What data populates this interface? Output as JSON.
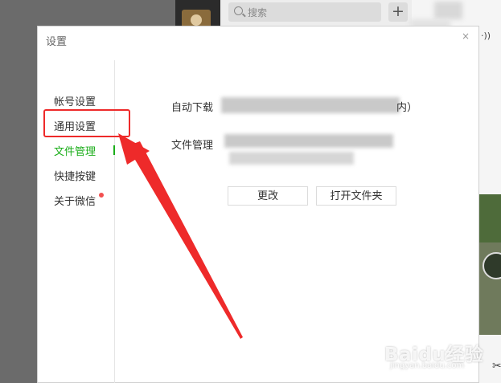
{
  "search": {
    "placeholder": "搜索"
  },
  "header": {
    "wifi_icon": "signal-icon"
  },
  "dialog": {
    "title": "设置",
    "close": "×",
    "nav": [
      {
        "label": "帐号设置",
        "active": false
      },
      {
        "label": "通用设置",
        "active": false
      },
      {
        "label": "文件管理",
        "active": true
      },
      {
        "label": "快捷按键",
        "active": false
      },
      {
        "label": "关于微信",
        "active": false,
        "badge": true
      }
    ],
    "download_label": "自动下载",
    "download_suffix": "内）",
    "file_mgmt_label": "文件管理",
    "change_button": "更改",
    "open_folder_button": "打开文件夹"
  },
  "annotation": {
    "color": "#ee2a2a"
  },
  "watermark": {
    "text": "Baidu经验",
    "sub": "jingyan.baidu.com"
  },
  "colors": {
    "accent": "#1aad19",
    "badge": "#f25050"
  }
}
